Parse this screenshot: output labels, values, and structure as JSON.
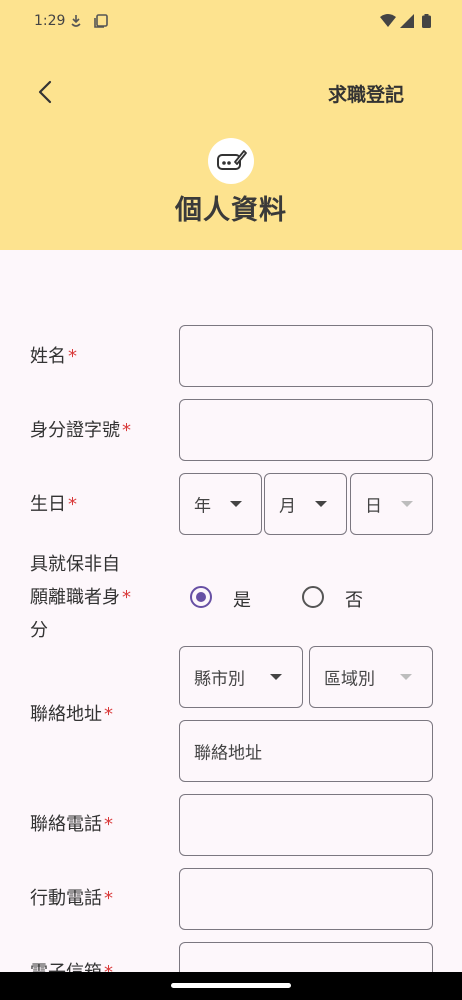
{
  "status": {
    "time": "1:29"
  },
  "header": {
    "app_title": "求職登記",
    "page_title": "個人資料"
  },
  "form": {
    "required_mark": "*",
    "name_label": "姓名",
    "id_label": "身分證字號",
    "birthday_label": "生日",
    "birthday": {
      "year": "年",
      "month": "月",
      "day": "日"
    },
    "involuntary": {
      "label_line1": "具就保非自",
      "label_line2": "願離職者身",
      "label_line3": "分",
      "yes": "是",
      "no": "否",
      "selected": "是"
    },
    "address_label": "聯絡地址",
    "city_placeholder": "縣市別",
    "district_placeholder": "區域別",
    "address_placeholder": "聯絡地址",
    "phone_label": "聯絡電話",
    "mobile_label": "行動電話",
    "email_label": "電子信箱"
  },
  "colors": {
    "header_bg": "#fde38f",
    "accent": "#6750a4",
    "required": "#d93a3a"
  }
}
